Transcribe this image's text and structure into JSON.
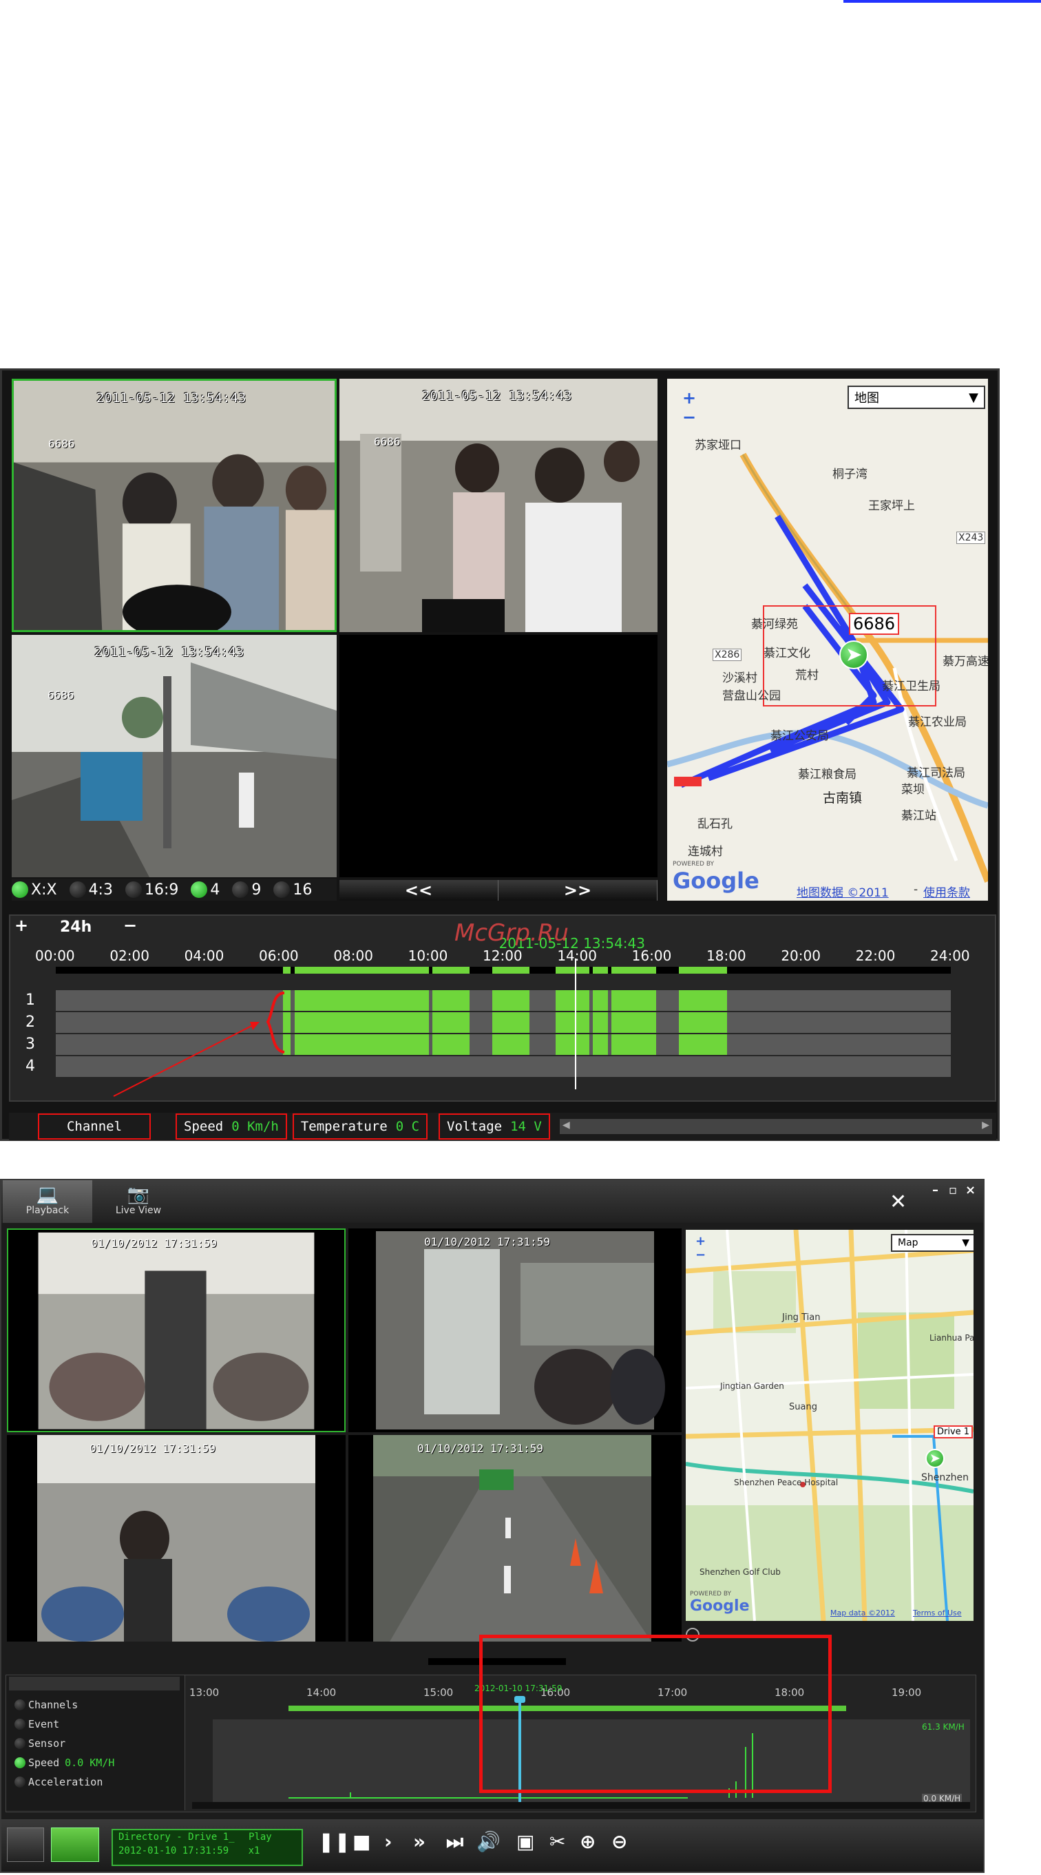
{
  "screenshot1": {
    "cameras": [
      {
        "timestamp": "2011-05-12 13:54:43",
        "id": "6686"
      },
      {
        "timestamp": "2011-05-12 13:54:43",
        "id": "6686"
      },
      {
        "timestamp": "2011-05-12 13:54:43",
        "id": "6686"
      }
    ],
    "layout_options": [
      "X:X",
      "4:3",
      "16:9",
      "4",
      "9",
      "16"
    ],
    "nav": {
      "prev": "<<",
      "next": ">>"
    },
    "map": {
      "type_selector": "地图",
      "zoom_in": "+",
      "zoom_out": "−",
      "vehicle_label": "6686",
      "places": [
        "苏家垭口",
        "桐子湾",
        "王家坪上",
        "X243",
        "綦河绿苑",
        "X286",
        "綦江文化",
        "沙溪村",
        "荒村",
        "营盘山公园",
        "綦江卫生局",
        "綦万高速",
        "綦江公安局",
        "綦江农业局",
        "綦江粮食局",
        "綦江司法局",
        "古南镇",
        "菜坝",
        "綦江站",
        "乱石孔",
        "连城村"
      ],
      "powered_by": "POWERED BY",
      "google": "Google",
      "map_data": "地图数据 ©2011",
      "separator": "-",
      "terms": "使用条款"
    },
    "timeline": {
      "zoom_in": "+",
      "range": "24h",
      "zoom_out": "−",
      "hours": [
        "00:00",
        "02:00",
        "04:00",
        "06:00",
        "08:00",
        "10:00",
        "12:00",
        "14:00",
        "16:00",
        "18:00",
        "20:00",
        "22:00",
        "24:00"
      ],
      "channels": [
        "1",
        "2",
        "3",
        "4"
      ],
      "cursor_time": "2011-05-12 13:54:43",
      "segments": [
        [
          6.1,
          6.3
        ],
        [
          6.4,
          10.0
        ],
        [
          10.1,
          11.1
        ],
        [
          11.7,
          12.7
        ],
        [
          13.4,
          14.3
        ],
        [
          14.4,
          14.8
        ],
        [
          14.9,
          16.1
        ],
        [
          16.7,
          18.0
        ]
      ]
    },
    "status": {
      "channel_label": "Channel",
      "speed_label": "Speed",
      "speed_value": "0 Km/h",
      "temperature_label": "Temperature",
      "temperature_value": "0 C",
      "voltage_label": "Voltage",
      "voltage_value": "14 V"
    }
  },
  "watermark": "McGrp.Ru",
  "screenshot2": {
    "tabs": [
      {
        "label": "Playback"
      },
      {
        "label": "Live View"
      }
    ],
    "window": {
      "minimize": "–",
      "restore": "▫",
      "close": "×"
    },
    "cameras": [
      {
        "timestamp": "01/10/2012 17:31:59"
      },
      {
        "timestamp": "01/10/2012 17:31:59"
      },
      {
        "timestamp": "01/10/2012 17:31:59"
      },
      {
        "timestamp": "01/10/2012 17:31:59"
      }
    ],
    "map": {
      "type_selector": "Map",
      "zoom_in": "+",
      "zoom_out": "−",
      "vehicle_label": "Drive 1",
      "places": [
        "Jing Tian",
        "Lianhua Park",
        "Jingtian Garden",
        "Suang",
        "Shenzhen",
        "Shenzhen Peace Hospital",
        "Shenzhen Golf Club"
      ],
      "powered_by": "POWERED BY",
      "google": "Google",
      "map_data": "Map data ©2012",
      "terms": "Terms of Use"
    },
    "sidebar": [
      {
        "label": "Channels",
        "value": "",
        "active": false
      },
      {
        "label": "Event",
        "value": "",
        "active": false
      },
      {
        "label": "Sensor",
        "value": "",
        "active": false
      },
      {
        "label": "Speed",
        "value": "0.0 KM/H",
        "active": true
      },
      {
        "label": "Acceleration",
        "value": "",
        "active": false
      }
    ],
    "timeline": {
      "hours": [
        "13:00",
        "14:00",
        "15:00",
        "16:00",
        "17:00",
        "18:00",
        "19:00"
      ],
      "cursor_time": "2012-01-10 17:31:59",
      "speed_max_label": "61.3 KM/H",
      "speed_min_label": "0.0 KM/H"
    },
    "controls": {
      "directory": "Directory - Drive 1_",
      "mode": "Play",
      "time": "2012-01-10 17:31:59",
      "speed": "x1"
    }
  }
}
